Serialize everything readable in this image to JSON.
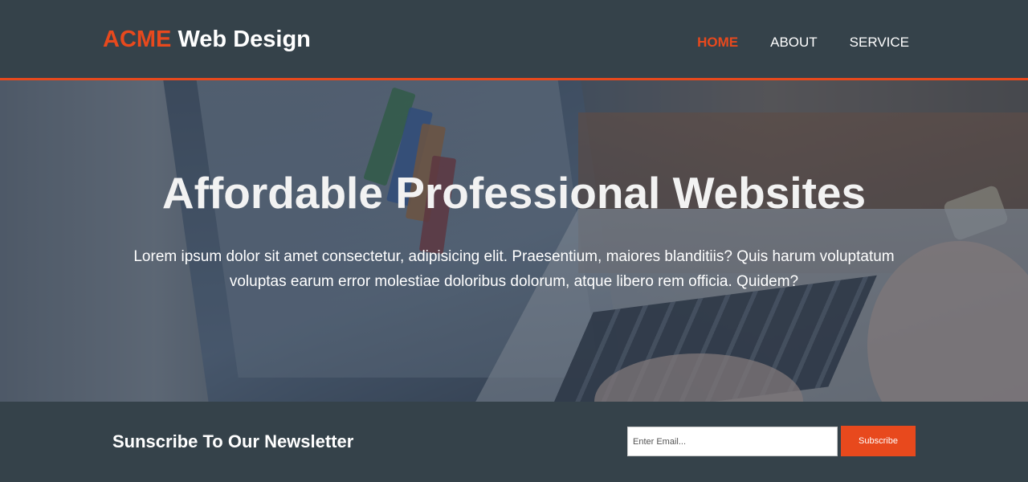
{
  "header": {
    "brand_highlight": "ACME",
    "brand_rest": " Web Design",
    "nav": [
      {
        "label": "HOME",
        "current": true
      },
      {
        "label": "ABOUT",
        "current": false
      },
      {
        "label": "SERVICE",
        "current": false
      }
    ]
  },
  "showcase": {
    "title": "Affordable Professional Websites",
    "text": "Lorem ipsum dolor sit amet consectetur, adipisicing elit. Praesentium, maiores blanditiis? Quis harum voluptatum voluptas earum error molestiae doloribus dolorum, atque libero rem officia. Quidem?"
  },
  "newsletter": {
    "title": "Sunscribe To Our Newsletter",
    "email_placeholder": "Enter Email...",
    "email_value": "",
    "subscribe_label": "Subscribe"
  },
  "colors": {
    "accent": "#e8491d",
    "dark": "#35424a",
    "text_light": "#ffffff"
  }
}
